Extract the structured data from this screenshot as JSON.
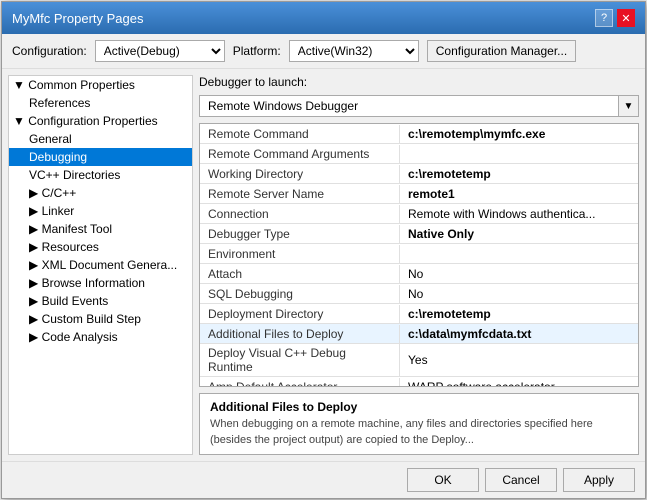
{
  "dialog": {
    "title": "MyMfc Property Pages",
    "help_btn": "?",
    "close_btn": "✕"
  },
  "toolbar": {
    "config_label": "Configuration:",
    "config_value": "Active(Debug)",
    "platform_label": "Platform:",
    "platform_value": "Active(Win32)",
    "config_mgr_label": "Configuration Manager..."
  },
  "tree": {
    "common_properties": "◢ Common Properties",
    "references": "References",
    "configuration_properties": "◢ Configuration Properties",
    "general": "General",
    "debugging": "Debugging",
    "vc_directories": "VC++ Directories",
    "cpp": "C/C++",
    "linker": "Linker",
    "manifest_tool": "Manifest Tool",
    "resources": "Resources",
    "xml_document": "XML Document Genera...",
    "browse_information": "Browse Information",
    "build_events": "Build Events",
    "custom_build_step": "Custom Build Step",
    "code_analysis": "Code Analysis"
  },
  "debugger": {
    "label": "Debugger to launch:",
    "value": "Remote Windows Debugger",
    "arrow": "▼"
  },
  "properties": [
    {
      "name": "Remote Command",
      "value": "c:\\remotemp\\mymfc.exe",
      "style": "bold"
    },
    {
      "name": "Remote Command Arguments",
      "value": "",
      "style": ""
    },
    {
      "name": "Working Directory",
      "value": "c:\\remotetemp",
      "style": "bold"
    },
    {
      "name": "Remote Server Name",
      "value": "remote1",
      "style": "bold"
    },
    {
      "name": "Connection",
      "value": "Remote with Windows authentica...",
      "style": ""
    },
    {
      "name": "Debugger Type",
      "value": "Native Only",
      "style": "bold"
    },
    {
      "name": "Environment",
      "value": "",
      "style": ""
    },
    {
      "name": "Attach",
      "value": "No",
      "style": ""
    },
    {
      "name": "SQL Debugging",
      "value": "No",
      "style": ""
    },
    {
      "name": "Deployment Directory",
      "value": "c:\\remotetemp",
      "style": "bold"
    },
    {
      "name": "Additional Files to Deploy",
      "value": "c:\\data\\mymfcdata.txt",
      "style": "bold"
    },
    {
      "name": "Deploy Visual C++ Debug Runtime",
      "value": "Yes",
      "style": ""
    },
    {
      "name": "Amp Default Accelerator",
      "value": "WARP software accelerator",
      "style": ""
    }
  ],
  "description": {
    "title": "Additional Files to Deploy",
    "text": "When debugging on a remote machine, any files and directories specified here (besides the project output) are copied to the Deploy..."
  },
  "buttons": {
    "ok": "OK",
    "cancel": "Cancel",
    "apply": "Apply"
  }
}
